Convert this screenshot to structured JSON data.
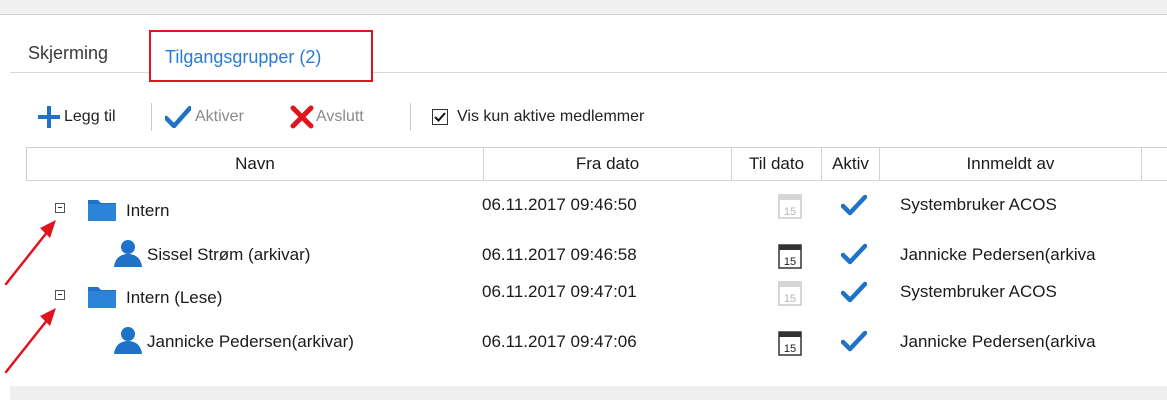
{
  "tabs": [
    {
      "label": "Skjerming"
    },
    {
      "label": "Tilgangsgrupper (2)"
    }
  ],
  "toolbar": {
    "add_label": "Legg til",
    "activate_label": "Aktiver",
    "end_label": "Avslutt",
    "checkbox_label": "Vis kun aktive medlemmer",
    "checkbox_checked": true
  },
  "grid": {
    "columns": [
      "Navn",
      "Fra dato",
      "Til dato",
      "Aktiv",
      "Innmeldt av"
    ],
    "rows": [
      {
        "type": "group",
        "name": "Intern",
        "from": "06.11.2017 09:46:50",
        "cal_text": "15",
        "cal_state": "disabled",
        "active": true,
        "by": "Systembruker ACOS"
      },
      {
        "type": "member",
        "name": "Sissel Strøm (arkivar)",
        "from": "06.11.2017 09:46:58",
        "cal_text": "15",
        "cal_state": "enabled",
        "active": true,
        "by": "Jannicke Pedersen(arkiva"
      },
      {
        "type": "group",
        "name": "Intern (Lese)",
        "from": "06.11.2017 09:47:01",
        "cal_text": "15",
        "cal_state": "disabled",
        "active": true,
        "by": "Systembruker ACOS"
      },
      {
        "type": "member",
        "name": "Jannicke Pedersen(arkivar)",
        "from": "06.11.2017 09:47:06",
        "cal_text": "15",
        "cal_state": "enabled",
        "active": true,
        "by": "Jannicke Pedersen(arkiva"
      }
    ]
  },
  "colors": {
    "accent": "#2a7bd4",
    "highlight_box": "#e0141e",
    "annotation_arrow": "#e0141e",
    "check": "#1e72c8",
    "delete": "#e0141e"
  }
}
